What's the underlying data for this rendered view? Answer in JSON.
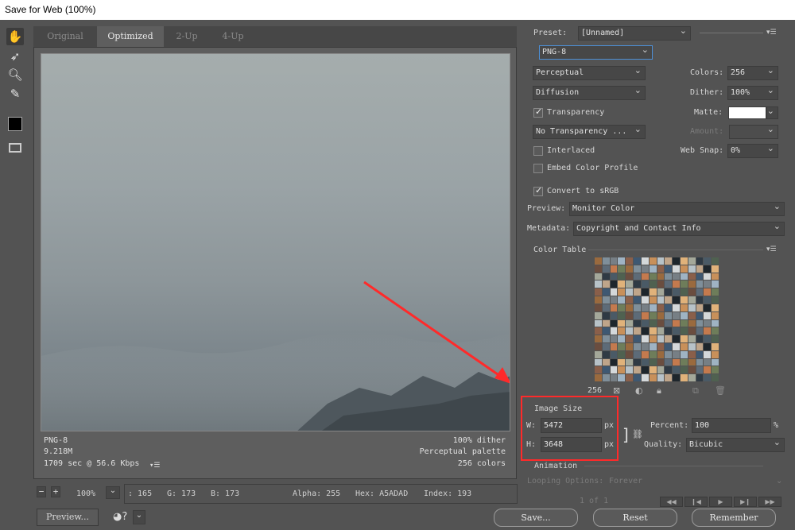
{
  "window": {
    "title": "Save for Web (100%)"
  },
  "tabs": [
    {
      "label": "Original"
    },
    {
      "label": "Optimized"
    },
    {
      "label": "2-Up"
    },
    {
      "label": "4-Up"
    }
  ],
  "image_info": {
    "format": "PNG-8",
    "size": "9.218M",
    "time": "1709 sec @ 56.6 Kbps",
    "dither": "100% dither",
    "palette": "Perceptual palette",
    "colors": "256 colors"
  },
  "status": {
    "zoom": "100%",
    "r": ": 165",
    "g": "G: 173",
    "b": "B: 173",
    "alpha": "Alpha: 255",
    "hex": "Hex: A5ADAD",
    "index": "Index: 193"
  },
  "footer": {
    "preview_label": "Preview...",
    "save_label": "Save...",
    "reset_label": "Reset",
    "remember_label": "Remember"
  },
  "panel": {
    "preset_label": "Preset:",
    "preset_value": "[Unnamed]",
    "format_value": "PNG-8",
    "reduction": "Perceptual",
    "colors_label": "Colors:",
    "colors_value": "256",
    "dither_algo": "Diffusion",
    "dither_label": "Dither:",
    "dither_value": "100%",
    "transparency_label": "Transparency",
    "matte_label": "Matte:",
    "transparency_dither": "No Transparency ...",
    "amount_label": "Amount:",
    "interlaced_label": "Interlaced",
    "web_snap_label": "Web Snap:",
    "web_snap_value": "0%",
    "embed_label": "Embed Color Profile",
    "convert_label": "Convert to sRGB",
    "preview_label": "Preview:",
    "preview_value": "Monitor Color",
    "metadata_label": "Metadata:",
    "metadata_value": "Copyright and Contact Info",
    "color_table_label": "Color Table",
    "color_count": "256",
    "image_size_label": "Image Size",
    "w_label": "W:",
    "w_value": "5472",
    "h_label": "H:",
    "h_value": "3648",
    "px": "px",
    "percent_label": "Percent:",
    "percent_value": "100",
    "percent_unit": "%",
    "quality_label": "Quality:",
    "quality_value": "Bicubic",
    "animation_label": "Animation",
    "looping_label": "Looping Options:",
    "looping_value": "Forever",
    "frame_count": "1 of 1"
  },
  "colors": {
    "accent_red": "#ff2a2a",
    "image_hex": "#A5ADAD"
  }
}
